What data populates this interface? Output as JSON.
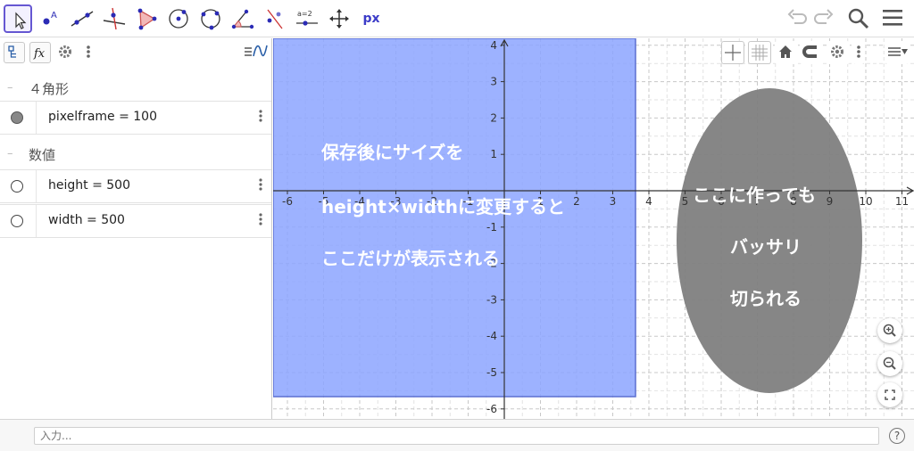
{
  "toolbar": {
    "tools": [
      "move-tool",
      "point-tool",
      "line-tool",
      "perpendicular-line-tool",
      "polygon-tool",
      "circle-center-point-tool",
      "circle-three-points-tool",
      "angle-tool",
      "reflect-tool",
      "slider-tool",
      "move-graphics-view-tool",
      "px-tool"
    ],
    "px_label": "px"
  },
  "algebra": {
    "groups": [
      {
        "label": "４角形"
      },
      {
        "label": "数値"
      }
    ],
    "rows": [
      {
        "definition": "pixelframe = 100",
        "marker": "filled"
      },
      {
        "definition": "height = 500",
        "marker": "empty"
      },
      {
        "definition": "width = 500",
        "marker": "empty"
      }
    ]
  },
  "graphics": {
    "x_ticks": [
      "-6",
      "-5",
      "-4",
      "-3",
      "-2",
      "-1",
      "1",
      "2",
      "3",
      "4",
      "5",
      "6",
      "7",
      "8",
      "9",
      "10",
      "11"
    ],
    "y_ticks": [
      "4",
      "3",
      "2",
      "1",
      "-1",
      "-2",
      "-3",
      "-4",
      "-5",
      "-6"
    ],
    "rect_color": "#8ca4ff",
    "ellipse_color": "#7f7f7f",
    "rect_text": [
      "保存後にサイズを",
      "height×widthに変更すると",
      "ここだけが表示される"
    ],
    "ellipse_text": [
      "ここに作っても",
      "バッサリ",
      "切られる"
    ]
  },
  "input": {
    "placeholder": "入力..."
  },
  "help_label": "?"
}
